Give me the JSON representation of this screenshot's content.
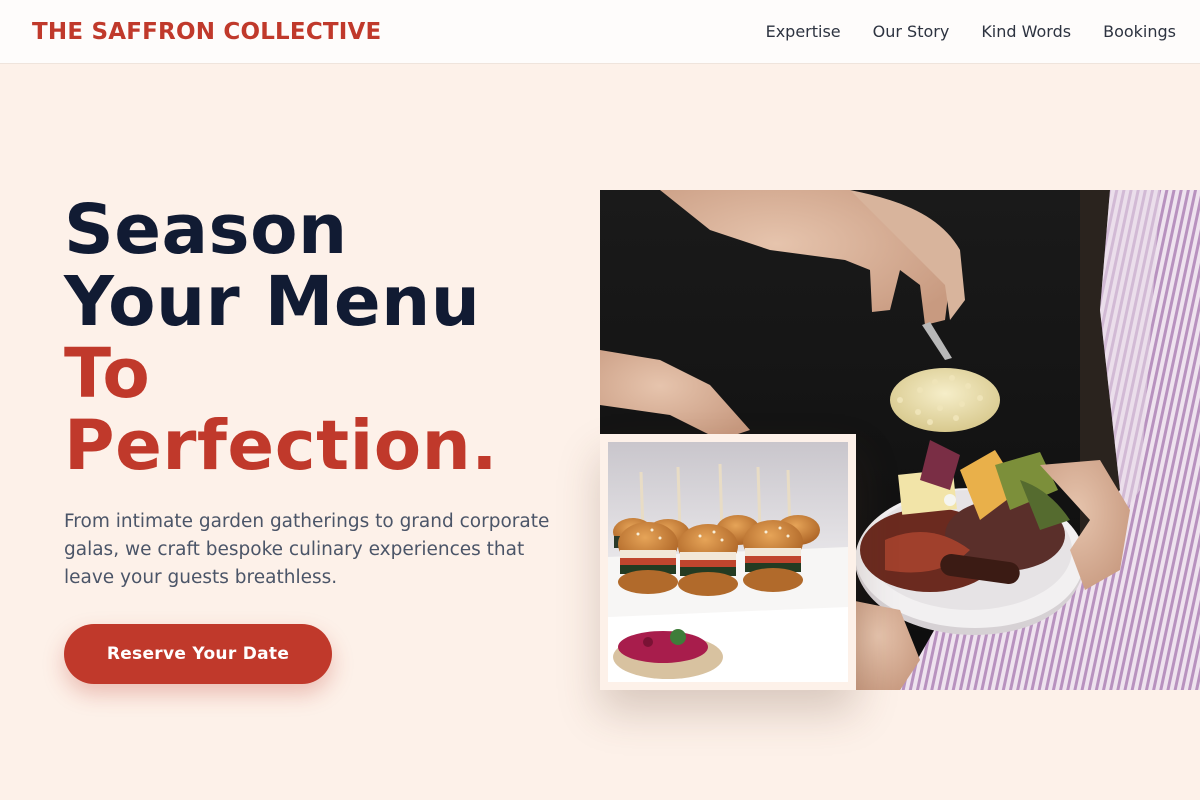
{
  "header": {
    "brand": "THE SAFFRON COLLECTIVE",
    "nav": [
      "Expertise",
      "Our Story",
      "Kind Words",
      "Bookings"
    ]
  },
  "hero": {
    "title_line1": "Season",
    "title_line2": "Your Menu",
    "title_line3": "To",
    "title_line4": "Perfection.",
    "subtitle": "From intimate garden gatherings to grand corporate galas, we craft bespoke culinary experiences that leave your guests breathless.",
    "cta_label": "Reserve Your Date"
  },
  "images": {
    "main": "chef-plating-photo",
    "inset": "slider-sandwiches-photo"
  },
  "colors": {
    "background": "#fdf1e9",
    "brand": "#c0392b",
    "heading": "#111b33",
    "body_text": "#4b5568"
  }
}
